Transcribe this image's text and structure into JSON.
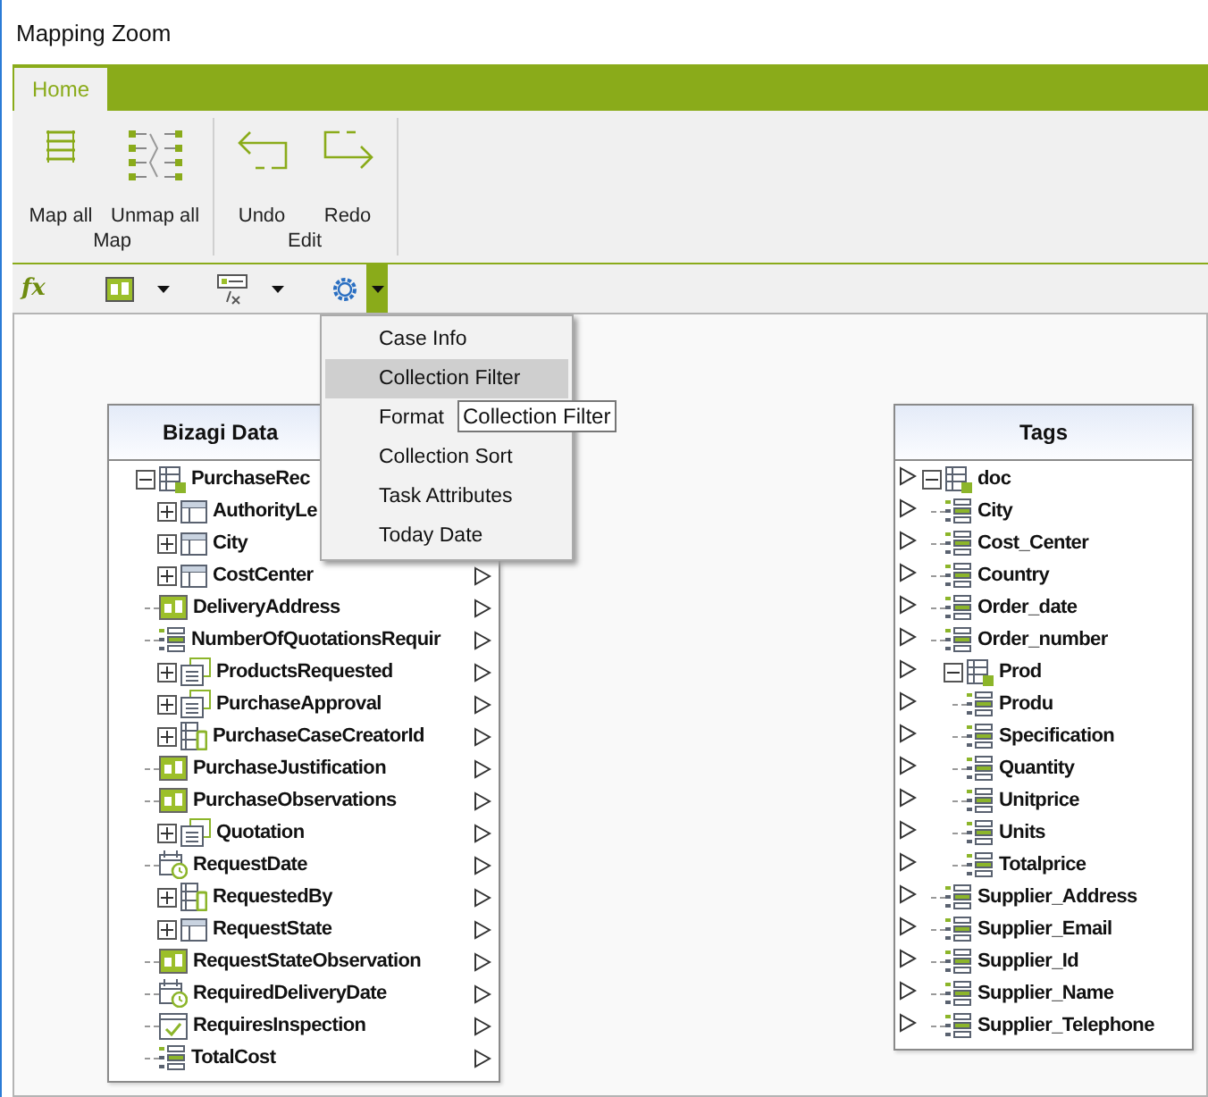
{
  "window": {
    "title": "Mapping Zoom"
  },
  "ribbon": {
    "tabs": [
      {
        "label": "Home",
        "selected": true
      }
    ],
    "groups": [
      {
        "label": "Map",
        "buttons": [
          {
            "label": "Map all",
            "kind": "map-all"
          },
          {
            "label": "Unmap all",
            "kind": "unmap-all"
          }
        ]
      },
      {
        "label": "Edit",
        "buttons": [
          {
            "label": "Undo",
            "kind": "undo"
          },
          {
            "label": "Redo",
            "kind": "redo"
          }
        ]
      }
    ]
  },
  "formula_bar": {
    "fx": "fx",
    "tools": [
      {
        "kind": "text",
        "open": false
      },
      {
        "kind": "formula",
        "open": false
      },
      {
        "kind": "gear",
        "open": true
      }
    ]
  },
  "dropdown_menu": {
    "items": [
      {
        "label": "Case Info",
        "selected": false
      },
      {
        "label": "Collection Filter",
        "selected": true
      },
      {
        "label": "Format",
        "selected": false
      },
      {
        "label": "Collection Sort",
        "selected": false
      },
      {
        "label": "Task Attributes",
        "selected": false
      },
      {
        "label": "Today Date",
        "selected": false
      }
    ]
  },
  "tooltip": "Collection Filter",
  "bizagi_data": {
    "title": "Bizagi Data",
    "items": [
      {
        "label": "PurchaseRec",
        "kind": "entity",
        "expanded": true,
        "children": [
          {
            "label": "AuthorityLe",
            "kind": "table",
            "expanded": false
          },
          {
            "label": "City",
            "kind": "table",
            "expanded": false
          },
          {
            "label": "CostCenter",
            "kind": "table",
            "expanded": false
          },
          {
            "label": "DeliveryAddress",
            "kind": "text"
          },
          {
            "label": "NumberOfQuotationsRequir",
            "kind": "number"
          },
          {
            "label": "ProductsRequested",
            "kind": "collection",
            "expanded": false
          },
          {
            "label": "PurchaseApproval",
            "kind": "collection",
            "expanded": false
          },
          {
            "label": "PurchaseCaseCreatorId",
            "kind": "user",
            "expanded": false
          },
          {
            "label": "PurchaseJustification",
            "kind": "text"
          },
          {
            "label": "PurchaseObservations",
            "kind": "text"
          },
          {
            "label": "Quotation",
            "kind": "collection",
            "expanded": false
          },
          {
            "label": "RequestDate",
            "kind": "date"
          },
          {
            "label": "RequestedBy",
            "kind": "user",
            "expanded": false
          },
          {
            "label": "RequestState",
            "kind": "table",
            "expanded": false
          },
          {
            "label": "RequestStateObservation",
            "kind": "text"
          },
          {
            "label": "RequiredDeliveryDate",
            "kind": "date"
          },
          {
            "label": "RequiresInspection",
            "kind": "boolean"
          },
          {
            "label": "TotalCost",
            "kind": "number"
          }
        ]
      }
    ]
  },
  "tags": {
    "title": "Tags",
    "items": [
      {
        "label": "doc",
        "kind": "entity",
        "expanded": true,
        "children": [
          {
            "label": "City",
            "kind": "number"
          },
          {
            "label": "Cost_Center",
            "kind": "number"
          },
          {
            "label": "Country",
            "kind": "number"
          },
          {
            "label": "Order_date",
            "kind": "number"
          },
          {
            "label": "Order_number",
            "kind": "number"
          },
          {
            "label": "Prod",
            "kind": "entity",
            "expanded": true,
            "children": [
              {
                "label": "Produ",
                "kind": "number"
              },
              {
                "label": "Specification",
                "kind": "number"
              },
              {
                "label": "Quantity",
                "kind": "number"
              },
              {
                "label": "Unitprice",
                "kind": "number"
              },
              {
                "label": "Units",
                "kind": "number"
              },
              {
                "label": "Totalprice",
                "kind": "number"
              }
            ]
          },
          {
            "label": "Supplier_Address",
            "kind": "number"
          },
          {
            "label": "Supplier_Email",
            "kind": "number"
          },
          {
            "label": "Supplier_Id",
            "kind": "number"
          },
          {
            "label": "Supplier_Name",
            "kind": "number"
          },
          {
            "label": "Supplier_Telephone",
            "kind": "number"
          }
        ]
      }
    ]
  }
}
